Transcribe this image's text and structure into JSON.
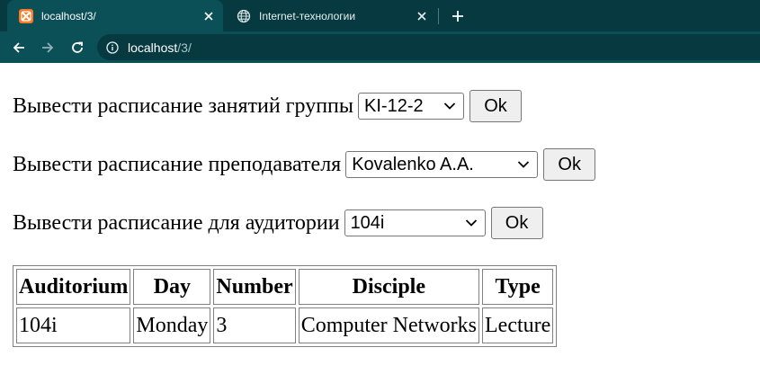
{
  "browser": {
    "tabs": [
      {
        "title": "localhost/3/",
        "active": true,
        "icon": "xampp-icon"
      },
      {
        "title": "Internet-технологии",
        "active": false,
        "icon": "globe-icon"
      }
    ],
    "address": {
      "host": "localhost",
      "path": "/3/"
    }
  },
  "page": {
    "forms": [
      {
        "label": "Вывести расписание занятий группы",
        "selected": "KI-12-2",
        "button": "Ok"
      },
      {
        "label": "Вывести расписание преподавателя",
        "selected": "Kovalenko A.A.",
        "button": "Ok"
      },
      {
        "label": "Вывести расписание для аудитории",
        "selected": "104i",
        "button": "Ok"
      }
    ],
    "table": {
      "headers": [
        "Auditorium",
        "Day",
        "Number",
        "Disciple",
        "Type"
      ],
      "rows": [
        [
          "104i",
          "Monday",
          "3",
          "Computer Networks",
          "Lecture"
        ]
      ]
    }
  },
  "colors": {
    "tabbar": "#073a40",
    "toolbar": "#0b4f57",
    "xampp_orange": "#fb7a24"
  }
}
